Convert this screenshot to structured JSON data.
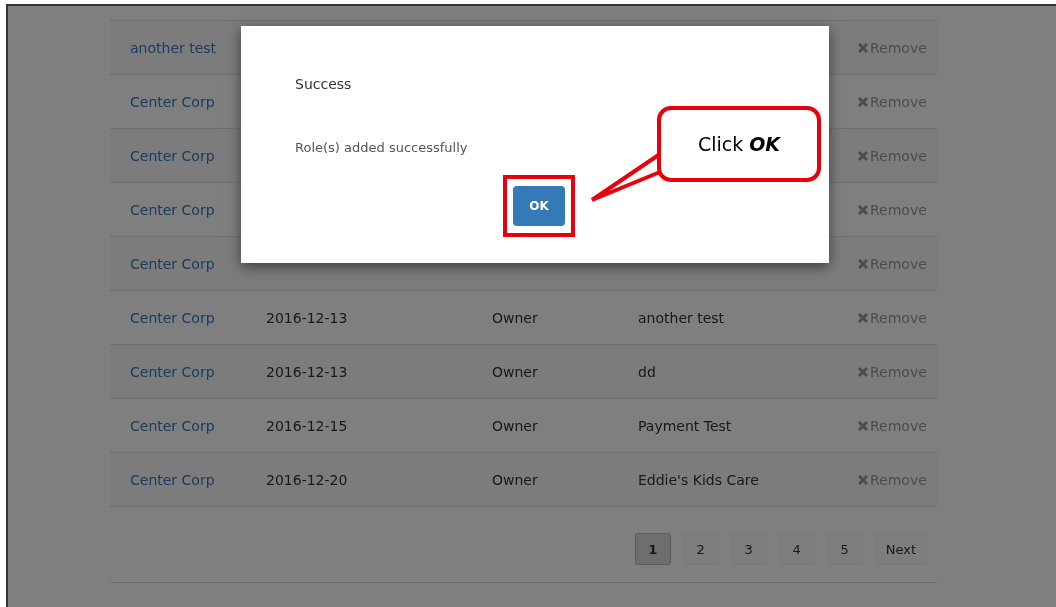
{
  "table": {
    "rows": [
      {
        "company": "another test",
        "action": "Remove"
      },
      {
        "company": "Center Corp",
        "action": "Remove"
      },
      {
        "company": "Center Corp",
        "action": "Remove"
      },
      {
        "company": "Center Corp",
        "action": "Remove"
      },
      {
        "company": "Center Corp",
        "action": "Remove"
      },
      {
        "company": "Center Corp",
        "date": "2016-12-13",
        "role": "Owner",
        "name": "another test",
        "action": "Remove"
      },
      {
        "company": "Center Corp",
        "date": "2016-12-13",
        "role": "Owner",
        "name": "dd",
        "action": "Remove"
      },
      {
        "company": "Center Corp",
        "date": "2016-12-15",
        "role": "Owner",
        "name": "Payment Test",
        "action": "Remove"
      },
      {
        "company": "Center Corp",
        "date": "2016-12-20",
        "role": "Owner",
        "name": "Eddie's Kids Care",
        "action": "Remove"
      }
    ]
  },
  "pagination": {
    "pages": [
      {
        "label": "1",
        "selected": true
      },
      {
        "label": "2",
        "selected": false
      },
      {
        "label": "3",
        "selected": false
      },
      {
        "label": "4",
        "selected": false
      },
      {
        "label": "5",
        "selected": false
      }
    ],
    "next": "Next"
  },
  "dialog": {
    "title": "Success",
    "message": "Role(s) added successfully",
    "button": "OK"
  },
  "callout": {
    "text": "Click **OK**"
  }
}
